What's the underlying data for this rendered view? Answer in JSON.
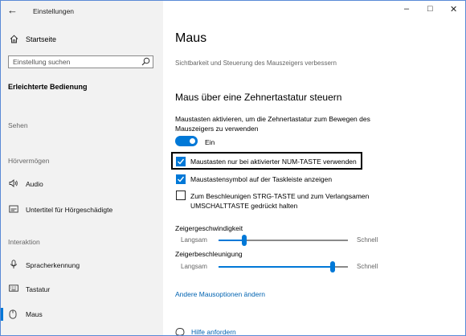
{
  "window": {
    "title": "Einstellungen",
    "back_icon": "back-arrow-icon",
    "controls": [
      "minimize-icon",
      "maximize-icon",
      "close-icon"
    ]
  },
  "sidebar": {
    "home_label": "Startseite",
    "search_placeholder": "Einstellung suchen",
    "category": "Erleichterte Bedienung",
    "sections": [
      {
        "title": "Sehen",
        "items": []
      },
      {
        "title": "Hörvermögen",
        "items": [
          {
            "label": "Audio",
            "icon": "speaker-icon"
          },
          {
            "label": "Untertitel für Hörgeschädigte",
            "icon": "captions-icon"
          }
        ]
      },
      {
        "title": "Interaktion",
        "items": [
          {
            "label": "Spracherkennung",
            "icon": "microphone-icon"
          },
          {
            "label": "Tastatur",
            "icon": "keyboard-icon"
          },
          {
            "label": "Maus",
            "icon": "mouse-icon",
            "selected": true
          }
        ]
      }
    ]
  },
  "main": {
    "title": "Maus",
    "subtitle": "Sichtbarkeit und Steuerung des Mauszeigers verbessern",
    "section_heading": "Maus über eine Zehnertastatur steuern",
    "description": "Maustasten aktivieren, um die Zehnertastatur zum Bewegen des Mauszeigers zu verwenden",
    "toggle": {
      "state": "Ein",
      "on": true
    },
    "checkboxes": [
      {
        "label": "Maustasten nur bei aktivierter NUM-TASTE verwenden",
        "checked": true,
        "focused": true
      },
      {
        "label": "Maustastensymbol auf der Taskleiste anzeigen",
        "checked": true
      },
      {
        "label": "Zum Beschleunigen STRG-TASTE und zum Verlangsamen UMSCHALTTASTE gedrückt halten",
        "checked": false
      }
    ],
    "sliders": [
      {
        "label": "Zeigergeschwindigkeit",
        "min_label": "Langsam",
        "max_label": "Schnell",
        "value": 0.2
      },
      {
        "label": "Zeigerbeschleunigung",
        "min_label": "Langsam",
        "max_label": "Schnell",
        "value": 0.88
      }
    ],
    "link": "Andere Mausoptionen ändern",
    "help_label": "Hilfe anfordern",
    "accent_color": "#0078d7"
  }
}
